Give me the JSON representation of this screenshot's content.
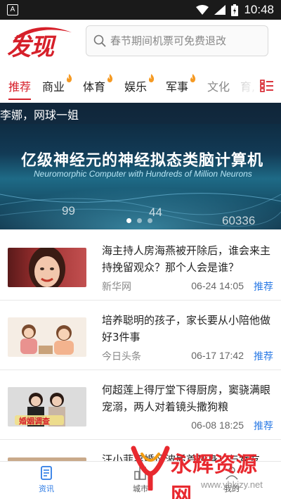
{
  "status_bar": {
    "app_icon": "A",
    "time": "10:48",
    "icons": [
      "wifi-icon",
      "signal-icon",
      "battery-icon"
    ]
  },
  "header": {
    "logo_text": "发现",
    "search": {
      "placeholder": "春节期间机票可免费退改"
    }
  },
  "tabs": [
    {
      "label": "推荐",
      "active": true,
      "hot": false
    },
    {
      "label": "商业",
      "active": false,
      "hot": true
    },
    {
      "label": "体育",
      "active": false,
      "hot": true
    },
    {
      "label": "娱乐",
      "active": false,
      "hot": true
    },
    {
      "label": "军事",
      "active": false,
      "hot": true
    },
    {
      "label": "文化",
      "active": false,
      "hot": false
    },
    {
      "label": "育,",
      "active": false,
      "hot": false
    }
  ],
  "banner": {
    "caption": "李娜，网球一姐",
    "headline": "亿级神经元的神经拟态类脑计算机",
    "subline": "Neuromorphic Computer with Hundreds of Million Neurons",
    "numbers": [
      "99",
      "44",
      "60336"
    ],
    "slide_count": 3,
    "active_slide": 0
  },
  "news": [
    {
      "title": "海主持人房海燕被开除后，谁会来主持挽留观众？那个人会是谁？",
      "source": "新华网",
      "date": "06-24 14:05",
      "tag": "推荐",
      "thumb_caption": ""
    },
    {
      "title": "培养聪明的孩子，家长要从小陪他做好3件事",
      "source": "今日头条",
      "date": "06-17 17:42",
      "tag": "推荐",
      "thumb_caption": ""
    },
    {
      "title": "何超莲上得厅堂下得厨房，窦骁满眼宠溺，两人对着镜头撒狗粮",
      "source": "",
      "date": "06-08 18:25",
      "tag": "推荐",
      "thumb_caption": "婚姻调查"
    },
    {
      "title": "汪小菲离婚风波后首现身！与女友",
      "source": "",
      "date": "",
      "tag": "",
      "thumb_caption": ""
    }
  ],
  "bottom_nav": [
    {
      "label": "资讯",
      "icon": "news-icon",
      "active": true
    },
    {
      "label": "城市",
      "icon": "city-icon",
      "active": false
    },
    {
      "label": "我的",
      "icon": "profile-icon",
      "active": false
    }
  ],
  "watermark": {
    "text": "永辉资源网",
    "url": "www.yhkjzy.net"
  },
  "colors": {
    "brand_red": "#d6202a",
    "link_blue": "#2c7be5",
    "muted": "#888888"
  }
}
